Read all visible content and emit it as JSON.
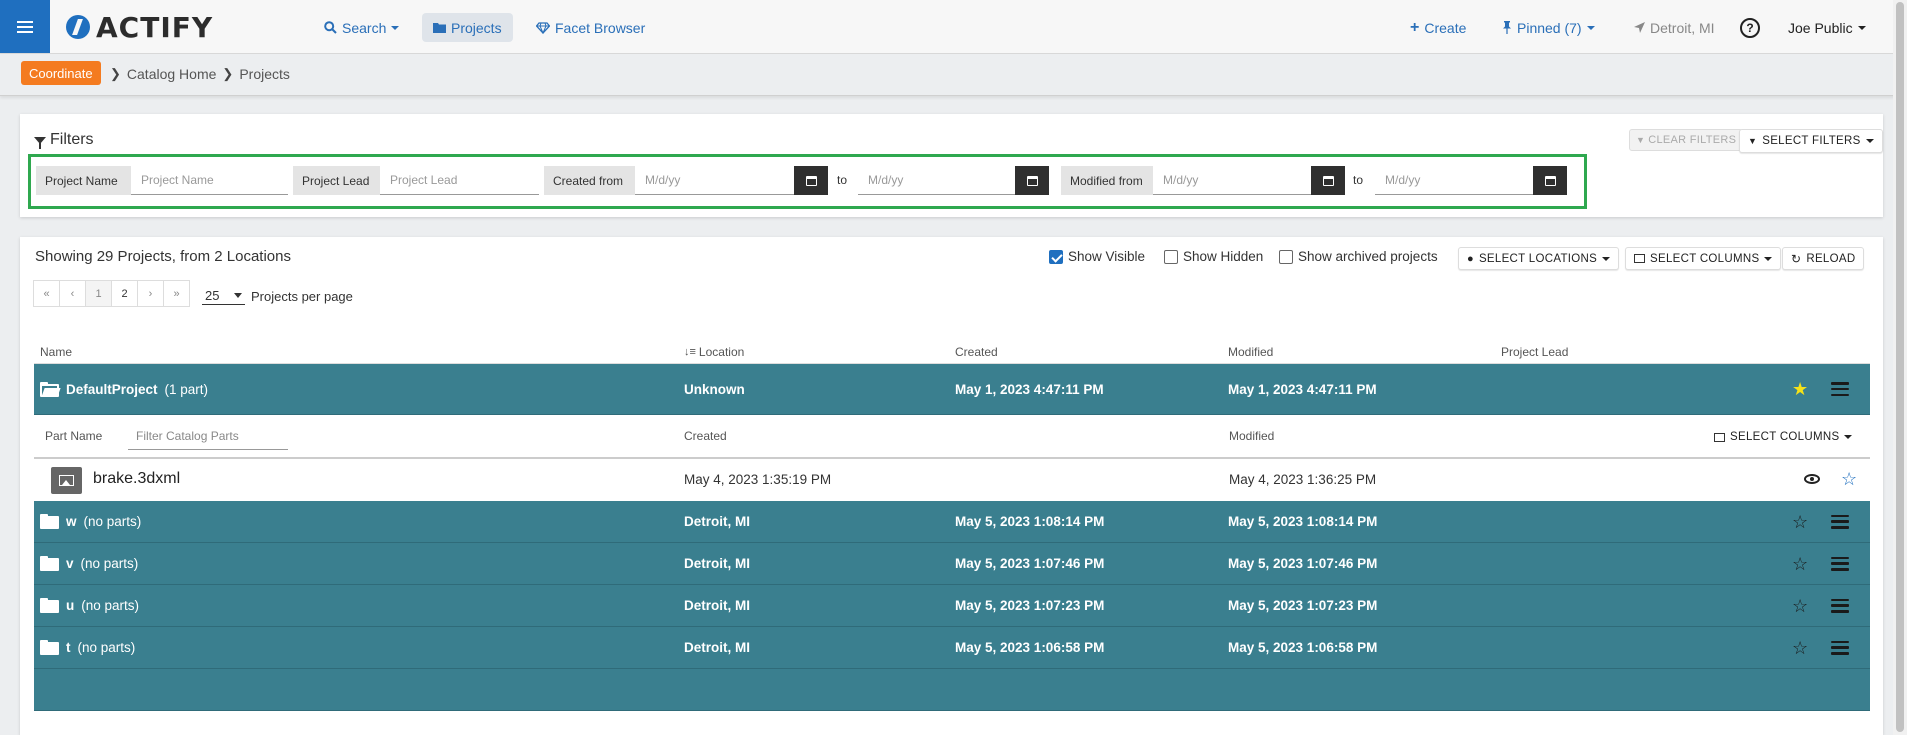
{
  "app": {
    "logo_text": "ACTIFY",
    "nav": [
      {
        "label": "Search",
        "icon": "search-icon"
      },
      {
        "label": "Projects",
        "icon": "folder-icon"
      },
      {
        "label": "Facet Browser",
        "icon": "diamond-icon"
      }
    ],
    "right": {
      "create": "Create",
      "pinned": "Pinned (7)",
      "location": "Detroit, MI",
      "help": "?",
      "user": "Joe Public"
    }
  },
  "breadcrumb": {
    "badge": "Coordinate",
    "items": [
      "Catalog Home",
      "Projects"
    ]
  },
  "filters": {
    "title": "Filters",
    "clear_label": "CLEAR FILTERS",
    "select_label": "SELECT FILTERS",
    "project_name_label": "Project Name",
    "project_name_placeholder": "Project Name",
    "project_lead_label": "Project Lead",
    "project_lead_placeholder": "Project Lead",
    "created_from_label": "Created from",
    "modified_from_label": "Modified from",
    "date_placeholder": "M/d/yy",
    "to_label": "to"
  },
  "list": {
    "showing": "Showing 29 Projects, from 2 Locations",
    "show_visible": "Show Visible",
    "show_hidden": "Show Hidden",
    "show_archived": "Show archived projects",
    "select_locations": "SELECT LOCATIONS",
    "select_columns": "SELECT COLUMNS",
    "reload": "RELOAD",
    "pager": [
      "«",
      "‹",
      "1",
      "2",
      "›",
      "»"
    ],
    "per_page_value": "25",
    "per_page_label": "Projects per page",
    "columns": {
      "name": "Name",
      "location": "Location",
      "created": "Created",
      "modified": "Modified",
      "project_lead": "Project Lead"
    },
    "projects": [
      {
        "name": "DefaultProject",
        "count": "(1 part)",
        "location": "Unknown",
        "created": "May 1, 2023 4:47:11 PM",
        "modified": "May 1, 2023 4:47:11 PM",
        "pinned": true
      },
      {
        "name": "w",
        "count": "(no parts)",
        "location": "Detroit, MI",
        "created": "May 5, 2023 1:08:14 PM",
        "modified": "May 5, 2023 1:08:14 PM",
        "pinned": false
      },
      {
        "name": "v",
        "count": "(no parts)",
        "location": "Detroit, MI",
        "created": "May 5, 2023 1:07:46 PM",
        "modified": "May 5, 2023 1:07:46 PM",
        "pinned": false
      },
      {
        "name": "u",
        "count": "(no parts)",
        "location": "Detroit, MI",
        "created": "May 5, 2023 1:07:23 PM",
        "modified": "May 5, 2023 1:07:23 PM",
        "pinned": false
      },
      {
        "name": "t",
        "count": "(no parts)",
        "location": "Detroit, MI",
        "created": "May 5, 2023 1:06:58 PM",
        "modified": "May 5, 2023 1:06:58 PM",
        "pinned": false
      }
    ],
    "parts": {
      "col_part_name": "Part Name",
      "filter_placeholder": "Filter Catalog Parts",
      "col_created": "Created",
      "col_modified": "Modified",
      "select_columns": "SELECT COLUMNS",
      "rows": [
        {
          "name": "brake.3dxml",
          "created": "May 4, 2023 1:35:19 PM",
          "modified": "May 4, 2023 1:36:25 PM"
        }
      ]
    }
  },
  "colors": {
    "brand_blue": "#1f6fbf",
    "badge_orange": "#f47b20",
    "row_teal": "#3a7f8f",
    "filter_outline_green": "#2fa84f",
    "pin_star_yellow": "#f5e218"
  }
}
